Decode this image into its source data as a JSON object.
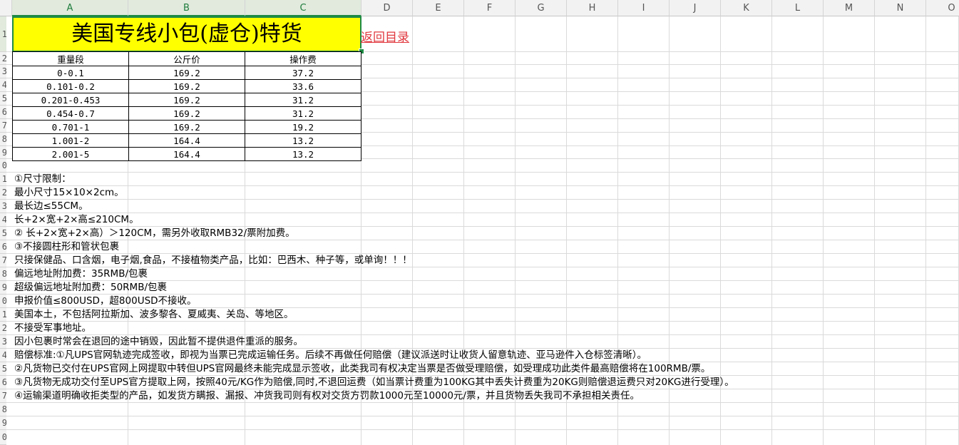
{
  "columns": [
    "A",
    "B",
    "C",
    "D",
    "E",
    "F",
    "G",
    "H",
    "I",
    "J",
    "K",
    "L",
    "M",
    "N",
    "O"
  ],
  "row_numbers": [
    "1",
    "2",
    "3",
    "4",
    "5",
    "6",
    "7",
    "8",
    "9",
    "0",
    "1",
    "2",
    "3",
    "4",
    "5",
    "6",
    "7",
    "8",
    "9",
    "0",
    "1",
    "2",
    "3",
    "4",
    "5",
    "6",
    "7",
    "8",
    "9",
    "0"
  ],
  "title": "美国专线小包(虚仓)特货",
  "back_link": "返回目录",
  "table": {
    "headers": [
      "重量段",
      "公斤价",
      "操作费"
    ],
    "rows": [
      [
        "0-0.1",
        "169.2",
        "37.2"
      ],
      [
        "0.101-0.2",
        "169.2",
        "33.6"
      ],
      [
        "0.201-0.453",
        "169.2",
        "31.2"
      ],
      [
        "0.454-0.7",
        "169.2",
        "31.2"
      ],
      [
        "0.701-1",
        "169.2",
        "19.2"
      ],
      [
        "1.001-2",
        "164.4",
        "13.2"
      ],
      [
        "2.001-5",
        "164.4",
        "13.2"
      ]
    ]
  },
  "notes": [
    "①尺寸限制：",
    "最小尺寸15×10×2cm。",
    "最长边≤55CM。",
    "长+2×宽+2×高≤210CM。",
    "② 长+2×宽+2×高）＞120CM，需另外收取RMB32/票附加费。",
    "③不接圆柱形和管状包裹",
    "只接保健品、口含烟，电子烟,食品，不接植物类产品，比如：巴西木、种子等，或单询！！！",
    "偏远地址附加费：35RMB/包裹",
    "超级偏远地址附加费：50RMB/包裹",
    "申报价值≤800USD，超800USD不接收。",
    "美国本土，不包括阿拉斯加、波多黎各、夏威夷、关岛、等地区。",
    "不接受军事地址。",
    "因小包裹时常会在退回的途中销毁，因此暂不提供退件重派的服务。",
    "赔偿标准:①凡UPS官网轨迹完成签收，即视为当票已完成运输任务。后续不再做任何赔偿（建议派送时让收货人留意轨迹、亚马逊件入仓标签清晰）。",
    "②凡货物已交付在UPS官网上网提取中转但UPS官网最终未能完成显示签收，此类我司有权决定当票是否做受理赔偿，如受理成功此类件最高赔偿将在100RMB/票。",
    "③凡货物无成功交付至UPS官方提取上网，按照40元/KG作为赔偿,同时,不退回运费（如当票计费重为100KG其中丢失计费重为20KG则赔偿退运费只对20KG进行受理）。",
    "④运输渠道明确收拒类型的产品，如发货方瞒报、漏报、冲货我司则有权对交货方罚款1000元至10000元/票，并且货物丢失我司不承担相关责任。"
  ],
  "colors": {
    "title_fill": "#ffff00",
    "selection": "#1e8a44",
    "link": "#e0383e"
  }
}
